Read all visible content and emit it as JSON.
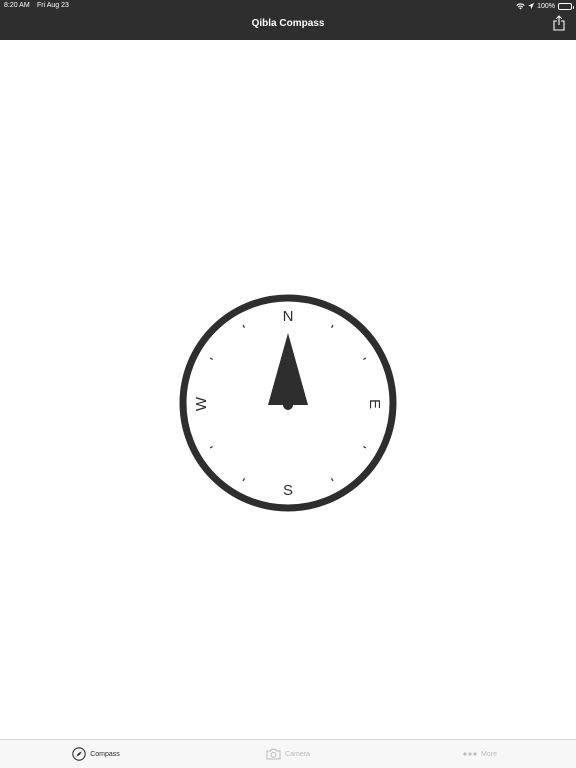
{
  "status_bar": {
    "time": "8:20 AM",
    "date": "Fri Aug 23",
    "battery": "100%",
    "icons": [
      "wifi-icon",
      "location-arrow-icon",
      "battery-icon"
    ]
  },
  "nav": {
    "title": "Qibla Compass",
    "share_icon": "share-icon"
  },
  "compass": {
    "north": "N",
    "south": "S",
    "east": "E",
    "west": "W",
    "heading_deg": 0
  },
  "tabs": [
    {
      "label": "Compass",
      "icon": "compass-icon",
      "active": true
    },
    {
      "label": "Camera",
      "icon": "camera-icon",
      "active": false
    },
    {
      "label": "More",
      "icon": "more-dots-icon",
      "active": false
    }
  ],
  "colors": {
    "header_bg": "#2e2e2e",
    "compass": "#2e2e2e",
    "tab_active": "#2e2e2e",
    "tab_inactive": "#bdbdbd",
    "background": "#ffffff"
  }
}
